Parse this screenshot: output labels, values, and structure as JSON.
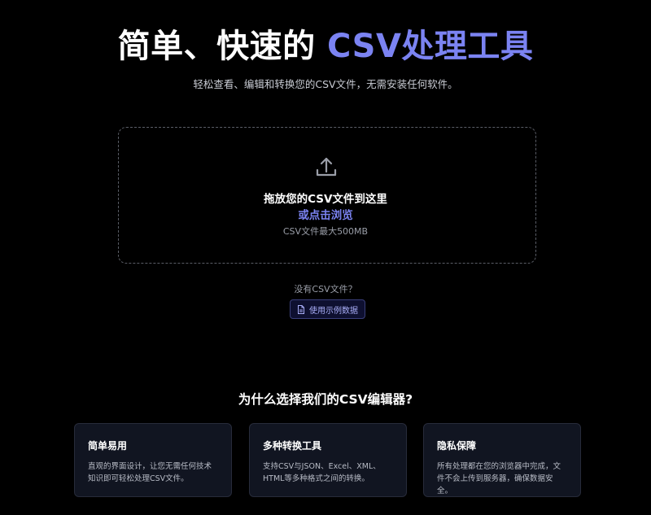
{
  "hero": {
    "title_main": "简单、快速的",
    "title_accent": "CSV处理工具",
    "subtitle": "轻松查看、编辑和转换您的CSV文件，无需安装任何软件。"
  },
  "dropzone": {
    "title": "拖放您的CSV文件到这里",
    "browse_label": "或点击浏览",
    "size_hint": "CSV文件最大500MB"
  },
  "sample": {
    "question": "没有CSV文件？",
    "button_label": "使用示例数据"
  },
  "features": {
    "heading": "为什么选择我们的CSV编辑器?",
    "cards": [
      {
        "title": "简单易用",
        "desc": "直观的界面设计，让您无需任何技术知识即可轻松处理CSV文件。"
      },
      {
        "title": "多种转换工具",
        "desc": "支持CSV与JSON、Excel、XML、HTML等多种格式之间的转换。"
      },
      {
        "title": "隐私保障",
        "desc": "所有处理都在您的浏览器中完成，文件不会上传到服务器，确保数据安全。"
      }
    ]
  },
  "colors": {
    "accent": "#7b83f2",
    "background": "#000000",
    "card_bg": "#111521"
  },
  "icons": [
    "upload-icon",
    "document-icon"
  ]
}
